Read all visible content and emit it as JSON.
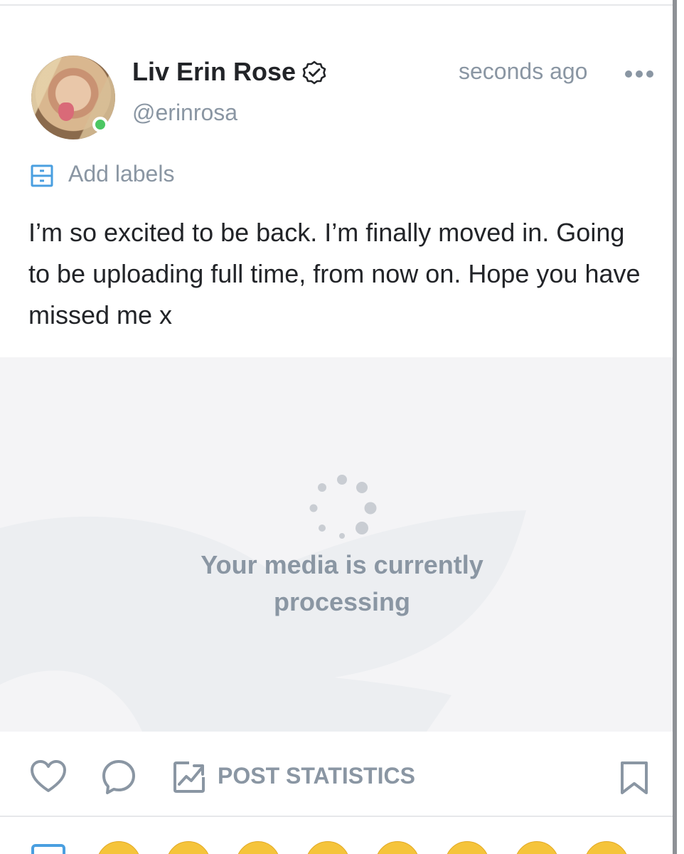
{
  "post": {
    "author": {
      "display_name": "Liv Erin Rose",
      "handle": "@erinrosa",
      "verified": true,
      "online": true
    },
    "timestamp": "seconds ago",
    "labels_action": "Add labels",
    "text": "I’m so excited to be back. I’m finally moved in. Go­ing to be uploading full time, from now on. Hope you have missed me x",
    "media": {
      "status_message": "Your media is currently processing"
    }
  },
  "actions": {
    "post_statistics_label": "POST STATISTICS"
  },
  "icons": [
    "verified-badge-icon",
    "more-icon",
    "labels-icon",
    "heart-icon",
    "comment-icon",
    "statistics-icon",
    "bookmark-icon",
    "gif-icon",
    "emoji-icon"
  ],
  "colors": {
    "text": "#222428",
    "muted": "#8a96a3",
    "accent": "#4a9fe0",
    "online": "#4cc763",
    "media_bg": "#f4f4f6"
  }
}
